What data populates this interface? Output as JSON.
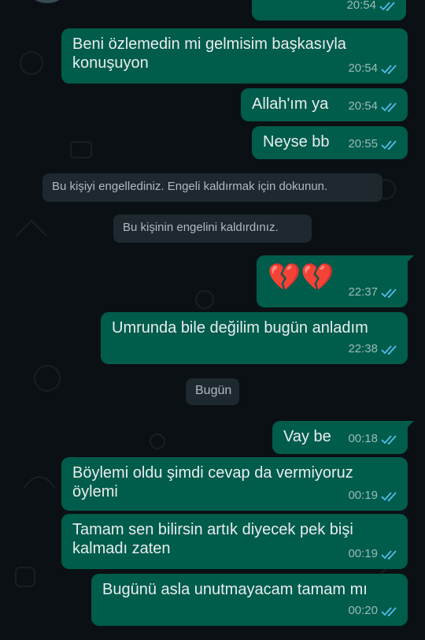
{
  "messages": [
    {
      "text": "",
      "time": "20:54"
    },
    {
      "text": "Beni özlemedin mi gelmisim başkasıyla konuşuyon",
      "time": "20:54"
    },
    {
      "text": "Allah'ım ya",
      "time": "20:54"
    },
    {
      "text": "Neyse bb",
      "time": "20:55"
    },
    {
      "text": "💔💔",
      "time": "22:37"
    },
    {
      "text": "Umrunda bile değilim bugün anladım",
      "time": "22:38"
    },
    {
      "text": "Vay be",
      "time": "00:18"
    },
    {
      "text": "Böylemi oldu şimdi cevap da vermiyoruz öylemi",
      "time": "00:19"
    },
    {
      "text": "Tamam sen bilirsin artık diyecek pek bişi kalmadı zaten",
      "time": "00:19"
    },
    {
      "text": "Bugünü asla unutmayacam tamam mı",
      "time": "00:20"
    }
  ],
  "system_notices": {
    "blocked": "Bu kişiyi engellediniz. Engeli kaldırmak için dokunun.",
    "unblocked": "Bu kişinin engelini kaldırdınız."
  },
  "date_divider": "Bugün",
  "colors": {
    "background": "#0b1014",
    "outgoing_bubble": "#005c4b",
    "system_chip": "#1d282f",
    "read_ticks": "#53bdeb"
  },
  "icons": {
    "read_receipt": "double-check-icon"
  }
}
